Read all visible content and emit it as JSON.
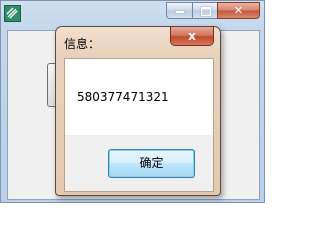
{
  "dialog": {
    "title": "信息：",
    "close_symbol": "x",
    "message": "580377471321",
    "ok_label": "确定"
  },
  "icons": {
    "app": "app-icon",
    "minimize": "minimize-icon",
    "maximize": "maximize-icon",
    "close": "close-icon"
  },
  "colors": {
    "close_button": "#c6563b",
    "ok_button_border": "#3c7fb1",
    "dialog_frame": "#e9d2bd"
  }
}
